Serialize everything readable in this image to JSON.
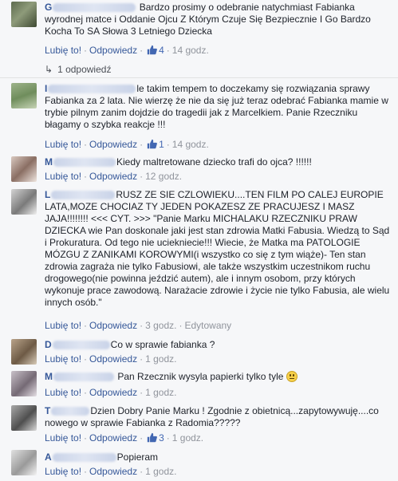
{
  "labels": {
    "like": "Lubię to!",
    "reply": "Odpowiedz",
    "edited": "Edytowany"
  },
  "comments": [
    {
      "author_suffix": "",
      "text": "Bardzo prosimy o odebranie natychmiast Fabianka wyrodnej matce i Oddanie Ojcu Z Którym Czuje Się Bezpiecznie I Go Bardzo Kocha To SA Słowa 3 Letniego Dziecka",
      "likes": "4",
      "time": "14 godz.",
      "replies_label": "1 odpowiedź"
    },
    {
      "author_suffix": "",
      "text": "le takim tempem to doczekamy się rozwiązania sprawy Fabianka za 2 lata. Nie wierzę że nie da się już teraz odebrać Fabianka mamie w trybie pilnym zanim dojdzie do tragedii jak z Marcelkiem. Panie Rzeczniku błagamy o szybka reakcje !!!",
      "likes": "1",
      "time": "14 godz."
    },
    {
      "author_suffix": "",
      "text": "Kiedy maltretowane dziecko trafi do ojca? !!!!!!",
      "time": "12 godz."
    },
    {
      "author_suffix": "",
      "text": "RUSZ ZE SIE CZLOWIEKU....TEN FILM PO CALEJ EUROPIE LATA,MOZE CHOCIAZ TY JEDEN POKAZESZ ZE PRACUJESZ I MASZ JAJA!!!!!!!! <<< CYT. >>> \"Panie Marku MICHALAKU RZECZNIKU PRAW DZIECKA wie Pan doskonale jaki jest stan zdrowia Matki Fabusia. Wiedzą to Sąd i Prokuratura. Od tego nie uciekniecie!!! Wiecie, że Matka ma PATOLOGIE MÓZGU Z ZANIKAMI KOROWYMI(i wszystko co się z tym wiąże)- Ten stan zdrowia zagraża nie tylko Fabusiowi, ale także wszystkim uczestnikom ruchu drogowego(nie powinna jeździć autem), ale i innym osobom, przy których wykonuje prace zawodową. Narażacie zdrowie i życie nie tylko Fabusia, ale wielu innych osób.\"",
      "time": "3 godz."
    },
    {
      "author_suffix": "",
      "text": "Co w sprawie fabianka ?",
      "time": "1 godz."
    },
    {
      "author_suffix": "",
      "text": "Pan Rzecznik wysyla papierki tylko tyle",
      "time": "1 godz."
    },
    {
      "author_suffix": "",
      "text": "Dzien Dobry Panie Marku ! Zgodnie z obietnicą...zapytowywuję....co nowego w sprawie Fabianka z Radomia?????",
      "likes": "3",
      "time": "1 godz."
    },
    {
      "author_suffix": "",
      "text": "Popieram",
      "time": "1 godz."
    }
  ],
  "author_initials": [
    "G",
    "I",
    "M",
    "L",
    "D",
    "M",
    "T",
    "A"
  ],
  "colors": {
    "link": "#365899",
    "like_blue": "#4267b2",
    "meta": "#90949c"
  }
}
